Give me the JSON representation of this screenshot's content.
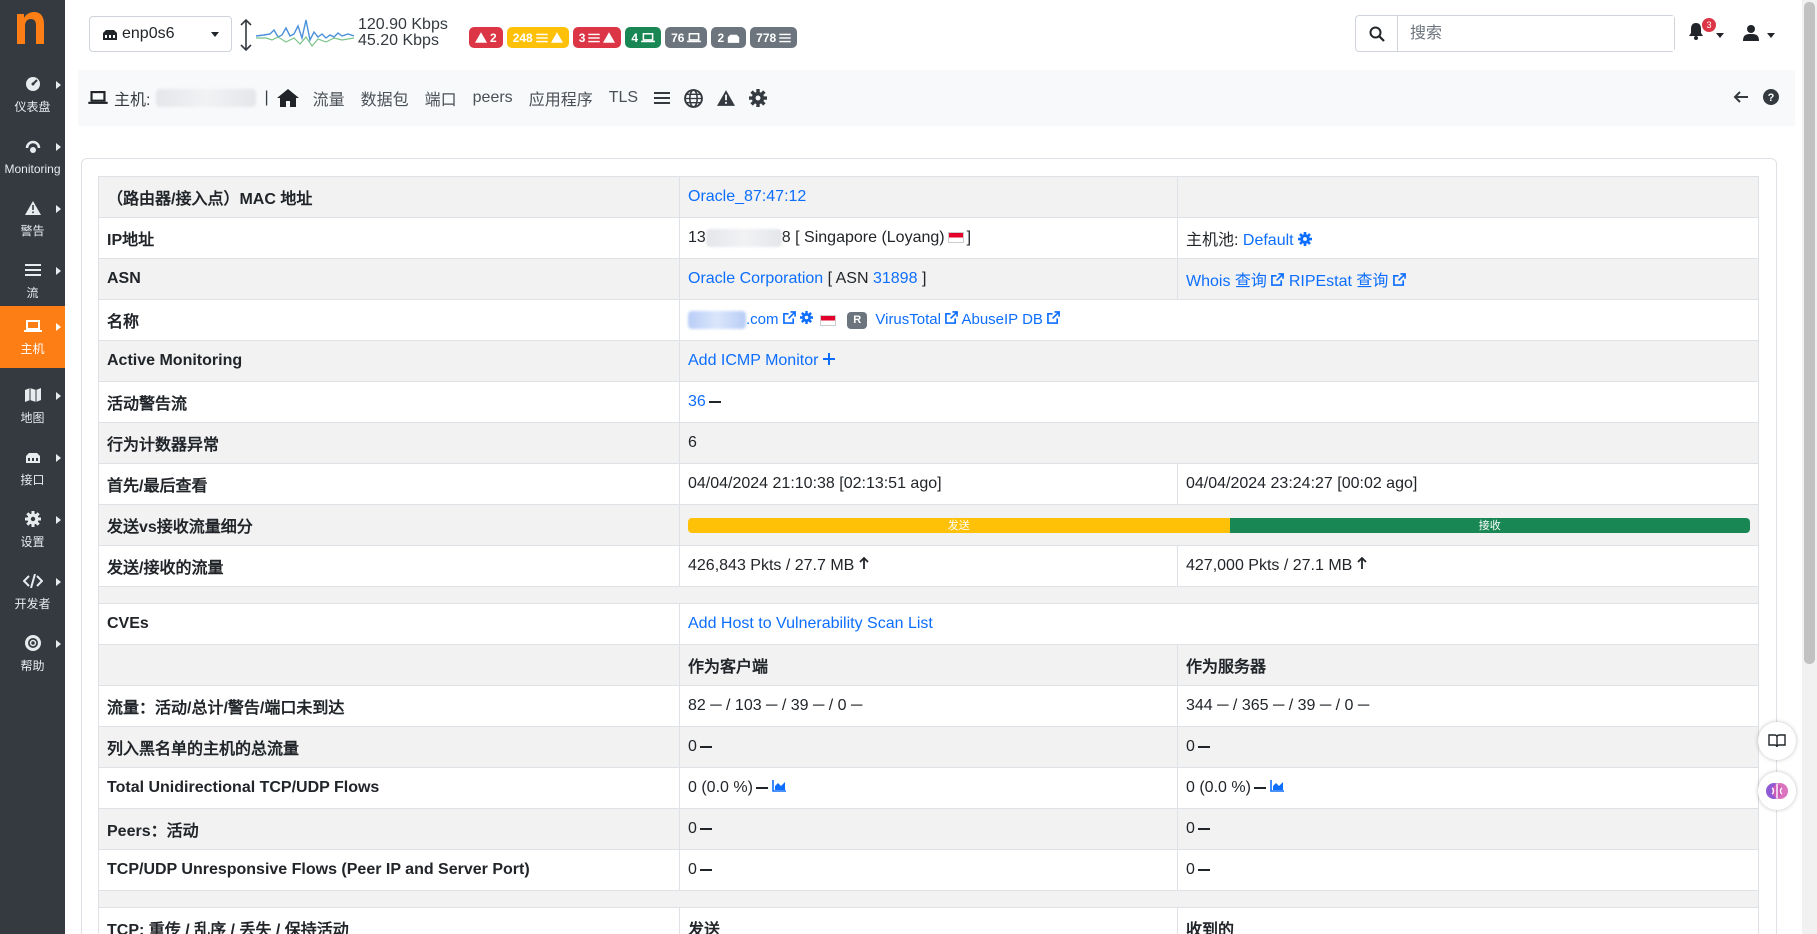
{
  "topbar": {
    "interface": "enp0s6",
    "speed_up": "120.90 Kbps",
    "speed_down": "45.20 Kbps",
    "badges": [
      {
        "text": "2",
        "icon": "warning-icon",
        "color": "#dc3545"
      },
      {
        "text": "248",
        "icon": "flows-warning-icon",
        "color": "#ffc107"
      },
      {
        "text": "3",
        "icon": "flows-warning-icon",
        "color": "#dc3545"
      },
      {
        "text": "4",
        "icon": "laptop-icon",
        "color": "#198754"
      },
      {
        "text": "76",
        "icon": "laptop-icon",
        "color": "#6c757d"
      },
      {
        "text": "2",
        "icon": "interface-icon",
        "color": "#6c757d"
      },
      {
        "text": "778",
        "icon": "flows-icon",
        "color": "#6c757d"
      }
    ],
    "search_placeholder": "搜索",
    "notification_count": "3"
  },
  "sidebar": {
    "items": [
      {
        "label": "仪表盘",
        "icon": "dashboard-icon"
      },
      {
        "label": "Monitoring",
        "icon": "monitoring-icon"
      },
      {
        "label": "警告",
        "icon": "warning-icon"
      },
      {
        "label": "流",
        "icon": "flows-icon"
      },
      {
        "label": "主机",
        "icon": "laptop-icon",
        "active": true
      },
      {
        "label": "地图",
        "icon": "map-icon"
      },
      {
        "label": "接口",
        "icon": "interface-icon"
      },
      {
        "label": "设置",
        "icon": "gear-icon"
      },
      {
        "label": "开发者",
        "icon": "code-icon"
      },
      {
        "label": "帮助",
        "icon": "lifebuoy-icon"
      }
    ]
  },
  "host_nav": {
    "host_label": "主机:",
    "links": [
      "流量",
      "数据包",
      "端口",
      "peers",
      "应用程序",
      "TLS"
    ]
  },
  "table": {
    "mac": {
      "label": "（路由器/接入点）MAC 地址",
      "value": "Oracle_87:47:12"
    },
    "ip": {
      "label": "IP地址",
      "prefix": "13",
      "suffix": "8",
      "location": "[ Singapore (Loyang)",
      "close": "]",
      "pool_label": "主机池:",
      "pool_value": "Default"
    },
    "asn": {
      "label": "ASN",
      "org": "Oracle Corporation",
      "asn_prefix": "[ ASN",
      "asn_num": "31898",
      "asn_close": "]",
      "whois": "Whois 查询",
      "ripe": "RIPEstat 查询"
    },
    "name": {
      "label": "名称",
      "domain_suffix": ".com",
      "r_badge": "R",
      "virustotal": "VirusTotal",
      "abuseip": "AbuseIP DB"
    },
    "active_monitoring": {
      "label": "Active Monitoring",
      "value": "Add ICMP Monitor"
    },
    "alerted_flows": {
      "label": "活动警告流",
      "value": "36"
    },
    "behavior": {
      "label": "行为计数器异常",
      "value": "6"
    },
    "first_last": {
      "label": "首先/最后查看",
      "first": "04/04/2024 21:10:38 [02:13:51 ago]",
      "last": "04/04/2024 23:24:27 [00:02 ago]"
    },
    "breakdown": {
      "label": "发送vs接收流量细分",
      "sent_label": "发送",
      "rcvd_label": "接收",
      "sent_fraction": 0.51
    },
    "traffic": {
      "label": "发送/接收的流量",
      "sent": "426,843 Pkts / 27.7 MB",
      "rcvd": "427,000 Pkts / 27.1 MB"
    },
    "cves": {
      "label": "CVEs",
      "value": "Add Host to Vulnerability Scan List"
    },
    "roles": {
      "client": "作为客户端",
      "server": "作为服务器"
    },
    "flows": {
      "label": "流量：活动/总计/警告/端口未到达",
      "client": "82 ─ / 103 ─ / 39 ─ / 0 ─",
      "server": "344 ─ / 365 ─ / 39 ─ / 0 ─"
    },
    "blacklisted": {
      "label": "列入黑名单的主机的总流量",
      "client": "0",
      "server": "0"
    },
    "unidirectional": {
      "label": "Total Unidirectional TCP/UDP Flows",
      "client": "0 (0.0 %)",
      "server": "0 (0.0 %)"
    },
    "peers": {
      "label": "Peers：活动",
      "client": "0",
      "server": "0"
    },
    "unresponsive": {
      "label": "TCP/UDP Unresponsive Flows (Peer IP and Server Port)",
      "client": "0",
      "server": "0"
    },
    "tcp": {
      "label": "TCP: 重传 / 乱序 / 丢失 / 保持活动",
      "sent": "发送",
      "rcvd": "收到的"
    }
  }
}
